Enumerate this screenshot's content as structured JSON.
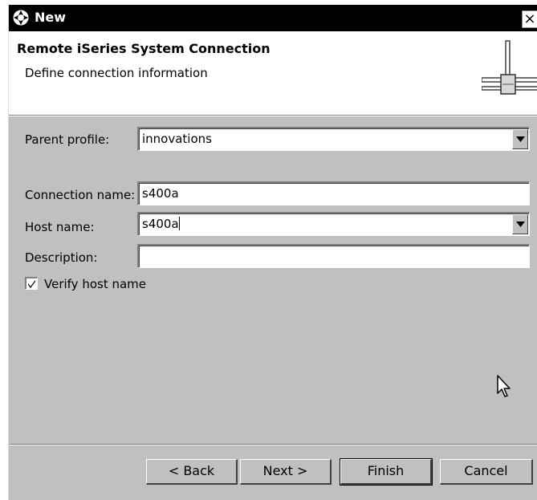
{
  "window": {
    "title": "New",
    "close_glyph": "×"
  },
  "header": {
    "title": "Remote iSeries System Connection",
    "subtitle": "Define connection information",
    "icon": "network-connection-icon"
  },
  "form": {
    "parent_profile": {
      "label": "Parent profile:",
      "value": "innovations"
    },
    "connection_name": {
      "label": "Connection name:",
      "value": "s400a"
    },
    "host_name": {
      "label": "Host name:",
      "value": "s400a"
    },
    "description": {
      "label": "Description:",
      "value": ""
    },
    "verify_host": {
      "label": "Verify host name",
      "checked": true
    }
  },
  "buttons": {
    "back": "< Back",
    "next": "Next >",
    "finish": "Finish",
    "cancel": "Cancel"
  },
  "colors": {
    "titlebar": "#000000",
    "dialog_bg": "#c0c0c0",
    "header_bg": "#ffffff"
  }
}
